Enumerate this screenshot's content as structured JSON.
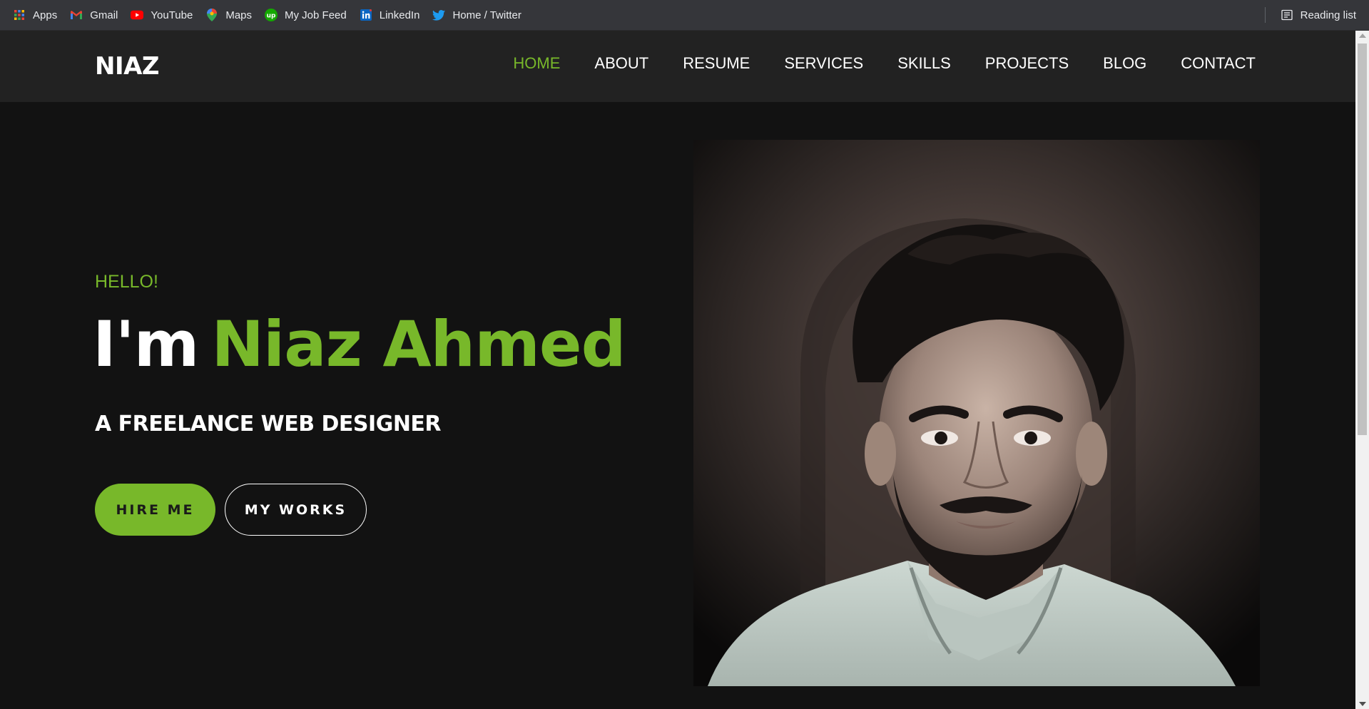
{
  "bookmarks": [
    {
      "label": "Apps",
      "icon": "apps-grid-icon"
    },
    {
      "label": "Gmail",
      "icon": "gmail-icon"
    },
    {
      "label": "YouTube",
      "icon": "youtube-icon"
    },
    {
      "label": "Maps",
      "icon": "maps-pin-icon"
    },
    {
      "label": "My Job Feed",
      "icon": "upwork-icon"
    },
    {
      "label": "LinkedIn",
      "icon": "linkedin-icon"
    },
    {
      "label": "Home / Twitter",
      "icon": "twitter-icon"
    }
  ],
  "reading_list": {
    "label": "Reading list",
    "icon": "reading-list-icon"
  },
  "header": {
    "logo": "NIAZ",
    "nav": [
      {
        "label": "HOME",
        "active": true
      },
      {
        "label": "ABOUT",
        "active": false
      },
      {
        "label": "RESUME",
        "active": false
      },
      {
        "label": "SERVICES",
        "active": false
      },
      {
        "label": "SKILLS",
        "active": false
      },
      {
        "label": "PROJECTS",
        "active": false
      },
      {
        "label": "BLOG",
        "active": false
      },
      {
        "label": "CONTACT",
        "active": false
      }
    ]
  },
  "hero": {
    "greeting": "HELLO!",
    "headline_prefix": "I'm",
    "headline_name": "Niaz Ahmed",
    "subtitle": "A FREELANCE WEB DESIGNER",
    "primary_button": "HIRE ME",
    "secondary_button": "MY WORKS"
  },
  "colors": {
    "accent": "#78b82a",
    "page_background": "#121212",
    "header_background": "#222222",
    "bookmarks_background": "#35363a"
  }
}
